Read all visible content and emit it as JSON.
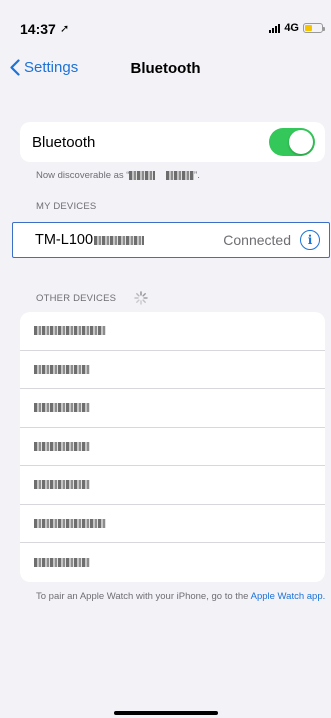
{
  "status_bar": {
    "time": "14:37",
    "network": "4G"
  },
  "nav": {
    "back_label": "Settings",
    "title": "Bluetooth"
  },
  "bluetooth": {
    "label": "Bluetooth",
    "enabled": true,
    "discoverable_text": "Now discoverable as “",
    "discoverable_suffix": "”."
  },
  "my_devices": {
    "header": "MY DEVICES",
    "items": [
      {
        "name": "TM-L100",
        "status": "Connected"
      }
    ]
  },
  "other_devices": {
    "header": "OTHER DEVICES",
    "count": 7
  },
  "footer": {
    "note": "To pair an Apple Watch with your iPhone, go to the",
    "link": "Apple Watch app."
  },
  "colors": {
    "accent": "#1d72d8",
    "toggle_on": "#34c759",
    "battery": "#f5c400"
  }
}
